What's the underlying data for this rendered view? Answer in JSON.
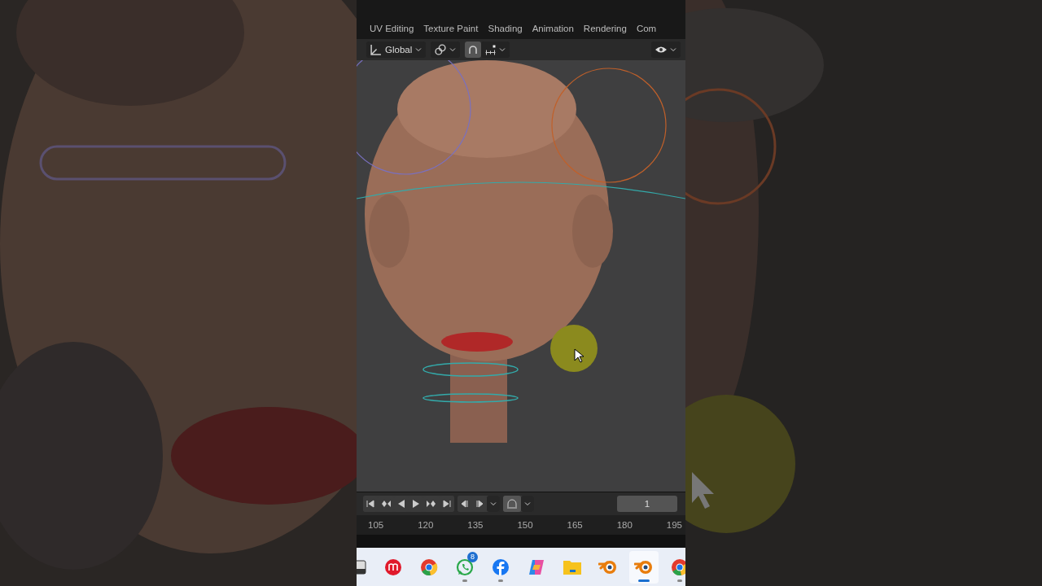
{
  "workspace_tabs": [
    {
      "label": "UV Editing"
    },
    {
      "label": "Texture Paint"
    },
    {
      "label": "Shading"
    },
    {
      "label": "Animation"
    },
    {
      "label": "Rendering"
    },
    {
      "label": "Com"
    }
  ],
  "viewport_header": {
    "orientation": "Global",
    "snap_on": true
  },
  "timeline": {
    "current_frame": "1",
    "ruler": [
      "105",
      "120",
      "135",
      "150",
      "165",
      "180",
      "195"
    ]
  },
  "taskbar": [
    {
      "kind": "window",
      "running": false,
      "selected": false
    },
    {
      "kind": "m-app",
      "running": false,
      "selected": false
    },
    {
      "kind": "chrome",
      "running": false,
      "selected": false
    },
    {
      "kind": "whatsapp",
      "running": true,
      "selected": false,
      "badge": "8"
    },
    {
      "kind": "facebook",
      "running": true,
      "selected": false
    },
    {
      "kind": "copilot",
      "running": false,
      "selected": false
    },
    {
      "kind": "folder",
      "running": false,
      "selected": false
    },
    {
      "kind": "blender",
      "running": false,
      "selected": false
    },
    {
      "kind": "blender",
      "running": true,
      "selected": true
    },
    {
      "kind": "chrome",
      "running": true,
      "selected": false
    }
  ]
}
